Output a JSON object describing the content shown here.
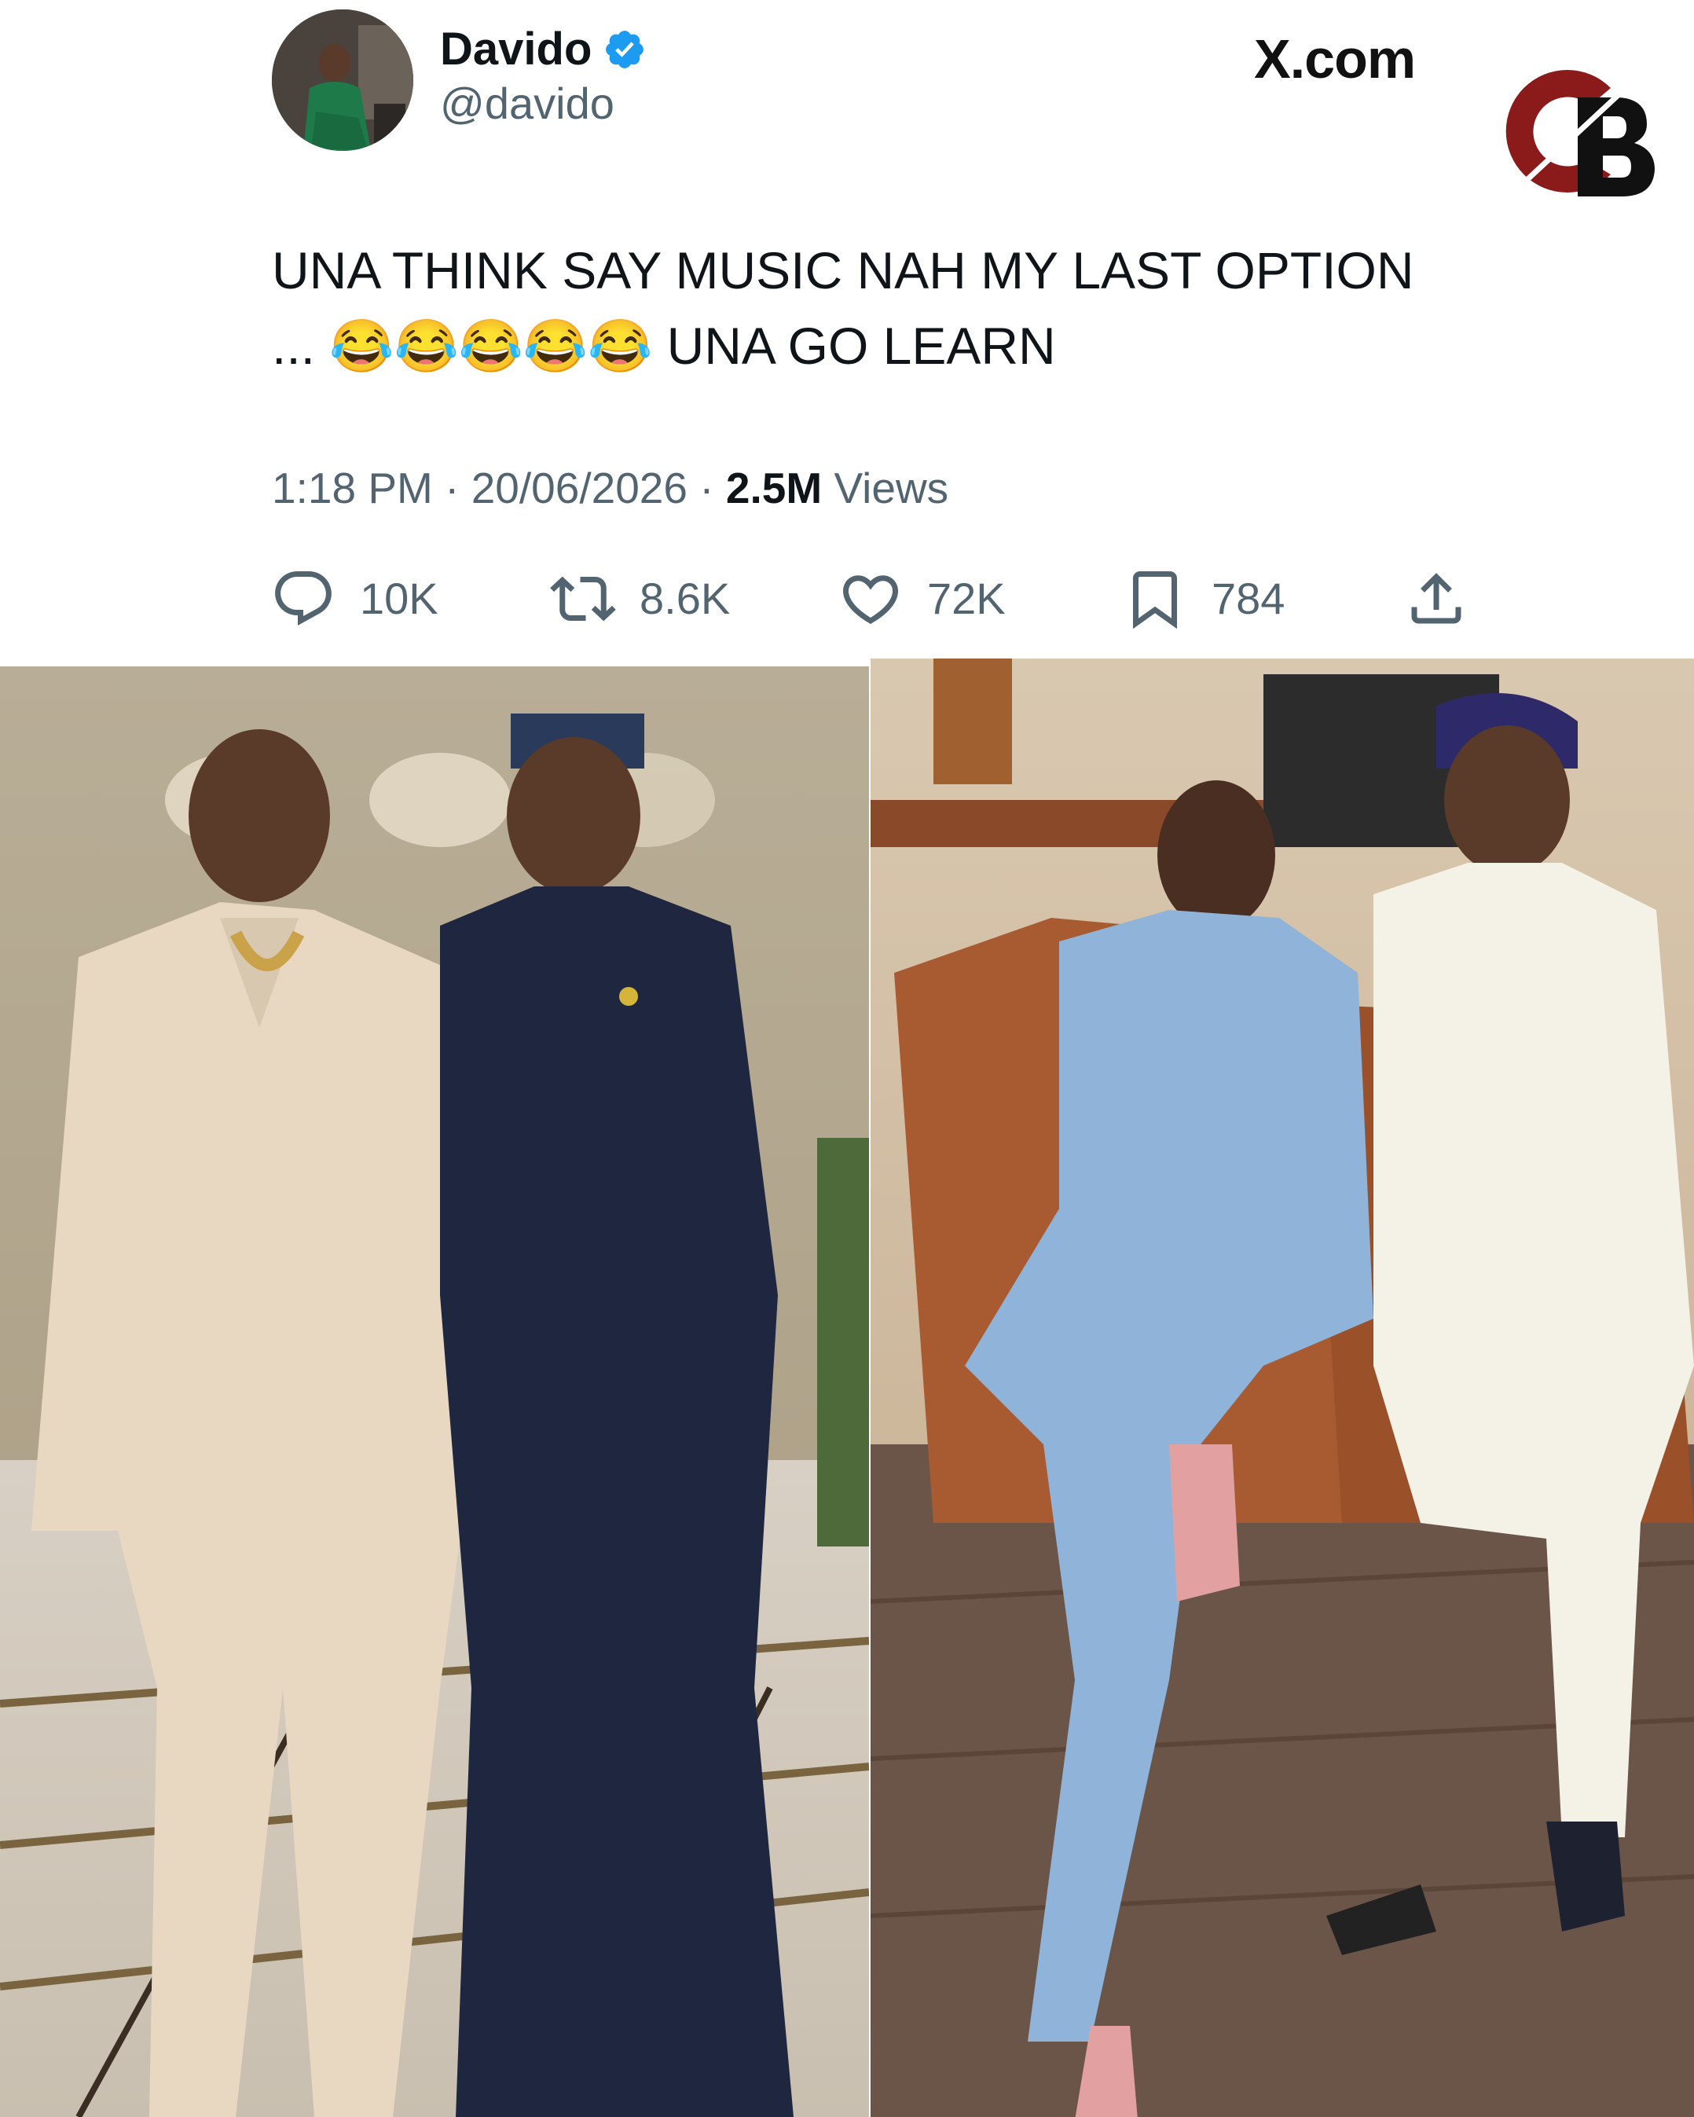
{
  "account": {
    "display_name": "Davido",
    "handle": "@davido",
    "verified": true,
    "avatar": "profile-photo"
  },
  "site": {
    "label": "X.com"
  },
  "watermark": {
    "text": "GB",
    "colors": [
      "#8b1a1a",
      "#111111"
    ]
  },
  "tweet": {
    "text": "UNA THINK SAY MUSIC NAH MY LAST OPTION\n... 😂😂😂😂😂 UNA GO LEARN"
  },
  "meta": {
    "time": "1:18 PM",
    "separator_1": " · ",
    "date": "20/06/2026",
    "separator_2": " · ",
    "views_count": "2.5M",
    "views_label": " Views"
  },
  "actions": {
    "replies": "10K",
    "reposts": "8.6K",
    "likes": "72K",
    "bookmarks": "784"
  },
  "icons": {
    "reply": "reply-icon",
    "repost": "repost-icon",
    "like": "heart-icon",
    "bookmark": "bookmark-icon",
    "share": "share-icon",
    "verified": "verified-badge-icon"
  },
  "colors": {
    "verified_blue": "#1d9bf0",
    "secondary_text": "#536471",
    "primary_text": "#0f1419"
  },
  "photos": [
    {
      "name": "photo-left",
      "subject": "two men standing in a lobby"
    },
    {
      "name": "photo-right",
      "subject": "two men seated in an office"
    }
  ]
}
